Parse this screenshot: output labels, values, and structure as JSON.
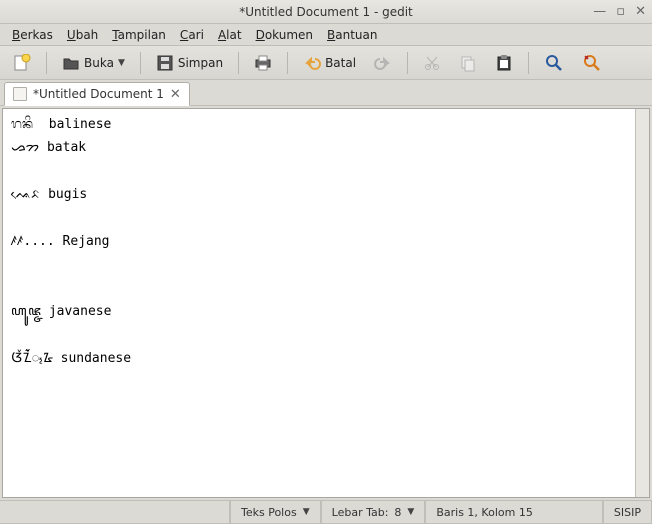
{
  "window": {
    "title": "*Untitled Document 1 - gedit"
  },
  "menubar": {
    "berkas": "Berkas",
    "ubah": "Ubah",
    "tampilan": "Tampilan",
    "cari": "Cari",
    "alat": "Alat",
    "dokumen": "Dokumen",
    "bantuan": "Bantuan"
  },
  "toolbar": {
    "buka": "Buka",
    "simpan": "Simpan",
    "batal": "Batal"
  },
  "tab": {
    "label": "*Untitled Document 1"
  },
  "document": {
    "lines": [
      "ᬭᬦᬶ  balinese",
      "ᯀᯂ batak",
      "",
      "ᨕᨙᨅ bugis",
      "",
      "ꤰꤰ.... Rejang",
      "",
      "",
      "ꦲꦸꦗ꧀ꦗ javanese",
      "",
      "ᮃᮨᮔᮁᮁᮁᮁᮁ᮪᮳ sundanese"
    ]
  },
  "statusbar": {
    "syntax": "Teks Polos",
    "tabwidth_label": "Lebar Tab:",
    "tabwidth_value": "8",
    "position": "Baris 1, Kolom 15",
    "mode": "SISIP"
  }
}
